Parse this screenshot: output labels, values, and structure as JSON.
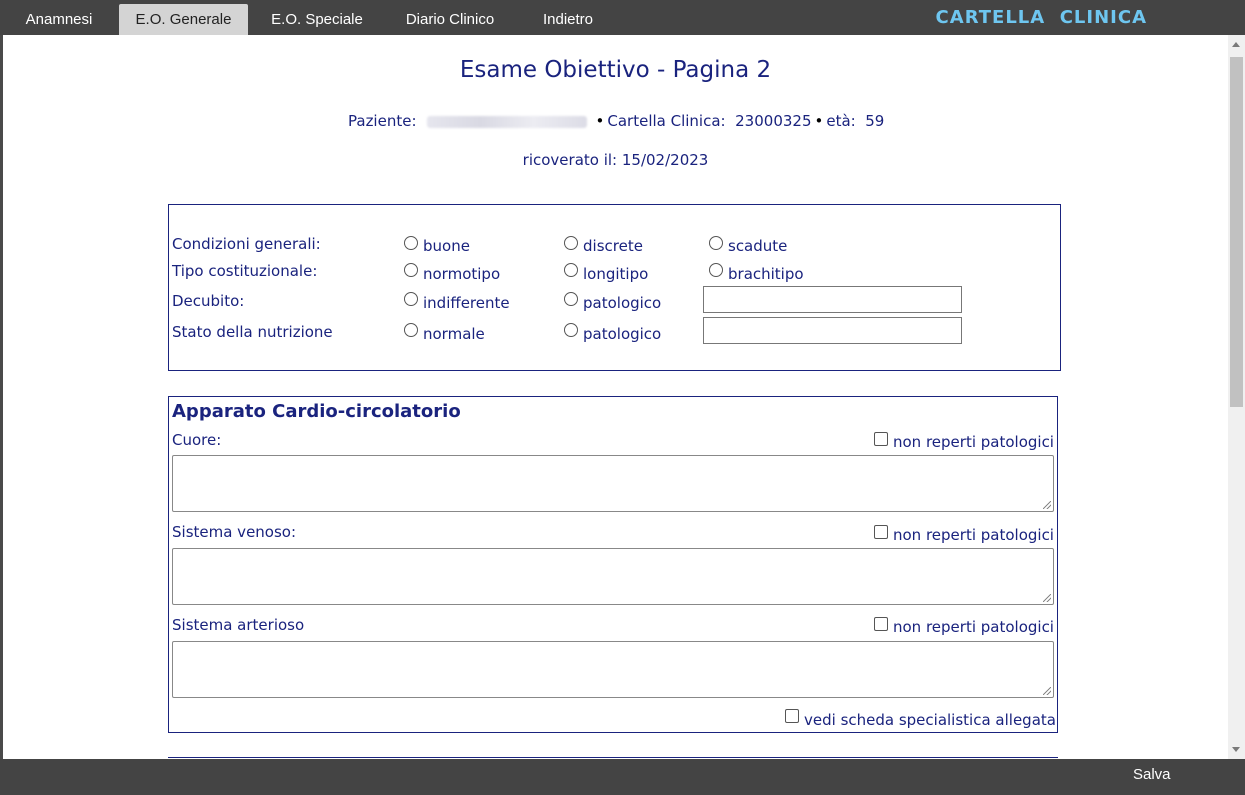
{
  "tabs": [
    {
      "label": "Anamnesi",
      "active": false
    },
    {
      "label": "E.O. Generale",
      "active": true
    },
    {
      "label": "E.O. Speciale",
      "active": false
    },
    {
      "label": "Diario Clinico",
      "active": false
    },
    {
      "label": "Indietro",
      "active": false
    }
  ],
  "app_title": "CARTELLA  CLINICA",
  "page_title": "Esame Obiettivo - Pagina 2",
  "patient": {
    "label": "Paziente:",
    "record_label": "Cartella Clinica:",
    "record_number": "23000325",
    "age_label": "età:",
    "age": "59",
    "admission": "ricoverato il: 15/02/2023"
  },
  "general": {
    "rows": [
      {
        "label": "Condizioni generali:",
        "options": [
          "buone",
          "discrete",
          "scadute"
        ]
      },
      {
        "label": "Tipo costituzionale:",
        "options": [
          "normotipo",
          "longitipo",
          "brachitipo"
        ]
      },
      {
        "label": "Decubito:",
        "options": [
          "indifferente",
          "patologico"
        ]
      },
      {
        "label": "Stato della nutrizione",
        "options": [
          "normale",
          "patologico"
        ]
      }
    ]
  },
  "cardio": {
    "title": "Apparato Cardio-circolatorio",
    "fields": [
      {
        "label": "Cuore:",
        "check_label": "non reperti patologici"
      },
      {
        "label": "Sistema venoso:",
        "check_label": "non reperti patologici"
      },
      {
        "label": "Sistema arterioso",
        "check_label": "non reperti patologici"
      }
    ],
    "specialist_label": "vedi scheda specialistica allegata"
  },
  "footer": {
    "save_label": "Salva"
  },
  "colors": {
    "bar": "#444444",
    "text": "#1a237e",
    "app_title": "#6ec6f0",
    "active_tab": "#d4d4d4"
  }
}
